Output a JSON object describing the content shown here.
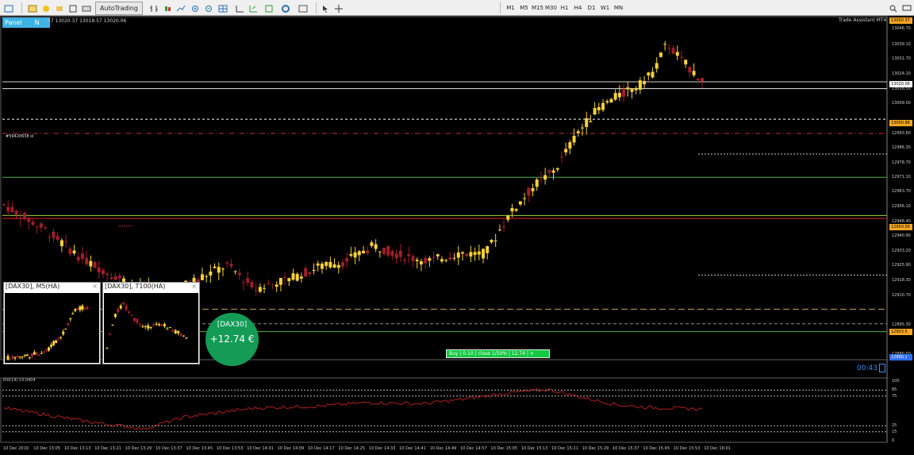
{
  "toolbar": {
    "autotrading_label": "AutoTrading",
    "timeframes": [
      "M1",
      "M5",
      "M15",
      "M30",
      "H1",
      "H4",
      "D1",
      "W1",
      "MN"
    ]
  },
  "panel": {
    "label": "Panel",
    "n_label": "N"
  },
  "top_info": "57 13020.37 13018.57 13020.06",
  "trade_assistant_label": "Trade Assistant MT4",
  "price_axis": {
    "labels": [
      "13039.10",
      "13031.70",
      "13024.10",
      "13016.50",
      "13009.00",
      "12993.60",
      "12986.30",
      "12978.70",
      "12971.10",
      "12963.70",
      "12956.10",
      "12948.40",
      "12940.90",
      "12933.20",
      "12925.90",
      "12918.30",
      "12910.70",
      "12895.30",
      "12880.50"
    ],
    "label_values": [
      13039.1,
      13031.7,
      13024.1,
      13016.5,
      13009.0,
      12993.6,
      12986.3,
      12978.7,
      12971.1,
      12963.7,
      12956.1,
      12948.4,
      12940.9,
      12933.2,
      12925.9,
      12918.3,
      12910.7,
      12895.3,
      12880.5
    ],
    "top_tag": "13050.37",
    "top_label": "13046.70",
    "bid_tag": "13020.06",
    "level_tag": "13000.86",
    "entry_tag": "12950.55",
    "order_tag": "12903.5",
    "lower_tag": "12890.1"
  },
  "order_label": "#59420638 sl",
  "mini_charts": [
    {
      "title": "[DAX30], M5(HA)",
      "close": "×"
    },
    {
      "title": "[DAX30], T100(HA)",
      "close": "×"
    }
  ],
  "profit": {
    "symbol": "[DAX30]",
    "value": "+12.74 €"
  },
  "trade_bar": "Buy | 0.10 | close 1/50% | 12.74 | ×",
  "timer": "00:43",
  "rsi": {
    "label": "RSI(14) 53.0404",
    "levels": [
      "100",
      "85",
      "75",
      "25",
      "15",
      "0"
    ],
    "level_values": [
      100,
      85,
      75,
      25,
      15,
      0
    ]
  },
  "time_axis": [
    "10 Dec 2019",
    "10 Dec 13:05",
    "10 Dec 13:13",
    "10 Dec 13:21",
    "10 Dec 13:29",
    "10 Dec 13:37",
    "10 Dec 13:45",
    "10 Dec 13:53",
    "10 Dec 14:01",
    "10 Dec 14:09",
    "10 Dec 14:17",
    "10 Dec 14:25",
    "10 Dec 14:33",
    "10 Dec 14:41",
    "10 Dec 14:49",
    "10 Dec 14:57",
    "10 Dec 15:05",
    "10 Dec 15:13",
    "10 Dec 15:21",
    "10 Dec 15:29",
    "10 Dec 15:37",
    "10 Dec 15:45",
    "10 Dec 15:53",
    "10 Dec 16:01"
  ],
  "colors": {
    "bull": "#f7d23a",
    "bear": "#a01e2a",
    "panel": "#3db3e4",
    "profit": "#149b56",
    "trade_bar": "#14c842",
    "rsi_line": "#b01e1e"
  },
  "chart_data": {
    "type": "candlestick",
    "y_range": [
      12878,
      13053
    ],
    "price_path": [
      [
        0,
        12957
      ],
      [
        0.06,
        12944
      ],
      [
        0.11,
        12930
      ],
      [
        0.15,
        12922
      ],
      [
        0.2,
        12914
      ],
      [
        0.24,
        12912
      ],
      [
        0.27,
        12918
      ],
      [
        0.32,
        12926
      ],
      [
        0.36,
        12914
      ],
      [
        0.41,
        12919
      ],
      [
        0.45,
        12925
      ],
      [
        0.49,
        12928
      ],
      [
        0.53,
        12936
      ],
      [
        0.57,
        12931
      ],
      [
        0.61,
        12928
      ],
      [
        0.65,
        12932
      ],
      [
        0.69,
        12932
      ],
      [
        0.72,
        12950
      ],
      [
        0.76,
        12967
      ],
      [
        0.79,
        12975
      ],
      [
        0.82,
        12993
      ],
      [
        0.85,
        13006
      ],
      [
        0.88,
        13013
      ],
      [
        0.91,
        13018
      ],
      [
        0.93,
        13025
      ],
      [
        0.95,
        13040
      ],
      [
        0.97,
        13031
      ],
      [
        1.0,
        13021
      ]
    ],
    "rsi_range": [
      0,
      100
    ],
    "rsi_path": [
      [
        0,
        55
      ],
      [
        0.12,
        32
      ],
      [
        0.2,
        20
      ],
      [
        0.26,
        40
      ],
      [
        0.36,
        55
      ],
      [
        0.45,
        58
      ],
      [
        0.52,
        64
      ],
      [
        0.6,
        62
      ],
      [
        0.66,
        70
      ],
      [
        0.72,
        80
      ],
      [
        0.78,
        86
      ],
      [
        0.83,
        72
      ],
      [
        0.88,
        60
      ],
      [
        0.92,
        56
      ],
      [
        1.0,
        53
      ]
    ]
  }
}
